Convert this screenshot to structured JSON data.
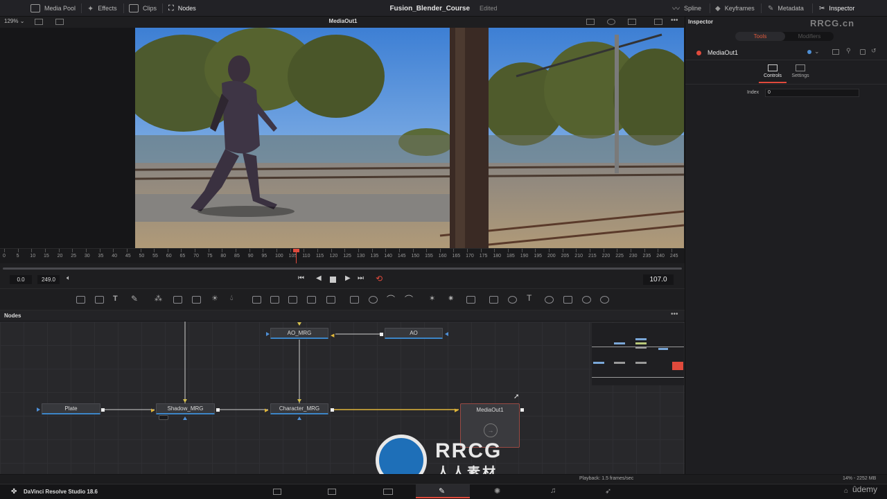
{
  "topbar": {
    "media_pool": "Media Pool",
    "effects": "Effects",
    "clips": "Clips",
    "nodes": "Nodes",
    "project_title": "Fusion_Blender_Course",
    "edited": "Edited",
    "spline": "Spline",
    "keyframes": "Keyframes",
    "metadata": "Metadata",
    "inspector": "Inspector"
  },
  "viewer": {
    "zoom": "129%",
    "title": "MediaOut1"
  },
  "timeline": {
    "ticks": [
      "0",
      "5",
      "10",
      "15",
      "20",
      "25",
      "30",
      "35",
      "40",
      "45",
      "50",
      "55",
      "60",
      "65",
      "70",
      "75",
      "80",
      "85",
      "90",
      "95",
      "100",
      "105",
      "110",
      "115",
      "120",
      "125",
      "130",
      "135",
      "140",
      "145",
      "150",
      "155",
      "160",
      "165",
      "170",
      "175",
      "180",
      "185",
      "190",
      "195",
      "200",
      "205",
      "210",
      "215",
      "220",
      "225",
      "230",
      "235",
      "240",
      "245"
    ],
    "playhead_frame": 107
  },
  "transport": {
    "start": "0.0",
    "end": "249.0",
    "current": "107.0"
  },
  "nodes_panel": {
    "title": "Nodes",
    "nodes": {
      "ao_mrg": "AO_MRG",
      "ao": "AO",
      "plate": "Plate",
      "shadow_mrg": "Shadow_MRG",
      "character_mrg": "Character_MRG",
      "media_out": "MediaOut1"
    }
  },
  "inspector": {
    "title": "Inspector",
    "tab_tools": "Tools",
    "tab_modifiers": "Modifiers",
    "node_name": "MediaOut1",
    "sub_controls": "Controls",
    "sub_settings": "Settings",
    "index_label": "Index",
    "index_value": "0"
  },
  "status": {
    "playback": "Playback: 1.5 frames/sec",
    "memory": "14% - 2252 MB"
  },
  "bottombar": {
    "app_name": "DaVinci Resolve Studio 18.6"
  },
  "watermark": {
    "corner": "RRCG.cn",
    "brand": "RRCG",
    "brand_sub": "人人素材",
    "udemy": "ûdemy"
  },
  "colors": {
    "accent_red": "#e04a3c",
    "link_blue": "#4e8fd6",
    "link_yellow": "#e0b63a",
    "bg": "#1c1c1e"
  }
}
